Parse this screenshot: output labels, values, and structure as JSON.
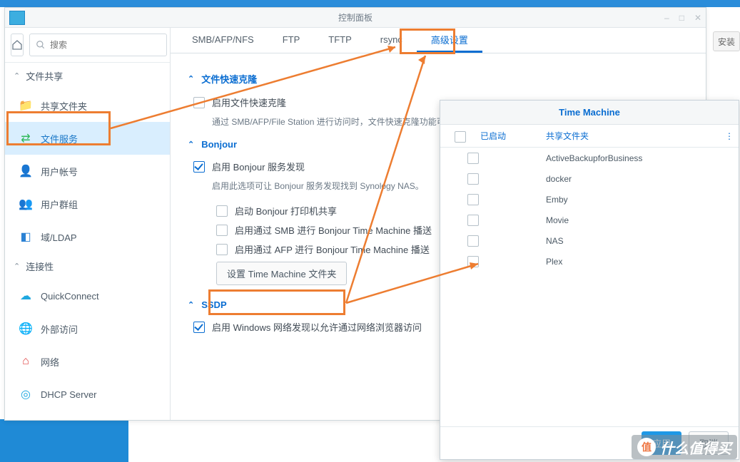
{
  "window": {
    "title": "控制面板"
  },
  "titlebar_controls": [
    "–",
    "□",
    "✕"
  ],
  "search": {
    "placeholder": "搜索"
  },
  "install_label": "安装",
  "sidebar": {
    "sections": [
      {
        "label": "文件共享",
        "items": [
          {
            "key": "shared-folder",
            "label": "共享文件夹",
            "color": "#f2a515",
            "glyph": "📁"
          },
          {
            "key": "file-services",
            "label": "文件服务",
            "color": "#2fb95a",
            "glyph": "⇄",
            "active": true
          },
          {
            "key": "user",
            "label": "用户帐号",
            "color": "#e6892b",
            "glyph": "👤"
          },
          {
            "key": "group",
            "label": "用户群组",
            "color": "#e6892b",
            "glyph": "👥"
          },
          {
            "key": "domain-ldap",
            "label": "域/LDAP",
            "color": "#2b82d4",
            "glyph": "◧"
          }
        ]
      },
      {
        "label": "连接性",
        "items": [
          {
            "key": "quickconnect",
            "label": "QuickConnect",
            "color": "#1fa8e0",
            "glyph": "☁"
          },
          {
            "key": "external-access",
            "label": "外部访问",
            "color": "#1fa8e0",
            "glyph": "🌐"
          },
          {
            "key": "network",
            "label": "网络",
            "color": "#e04040",
            "glyph": "⌂"
          },
          {
            "key": "dhcp",
            "label": "DHCP Server",
            "color": "#1fa8e0",
            "glyph": "◎"
          }
        ]
      }
    ]
  },
  "tabs": [
    "SMB/AFP/NFS",
    "FTP",
    "TFTP",
    "rsync",
    "高级设置"
  ],
  "active_tab": 4,
  "pane": {
    "group1": {
      "title": "文件快速克隆",
      "chk1": "启用文件快速克隆",
      "desc": "通过 SMB/AFP/File Station 进行访问时，文件快速克隆功能可让数据块将仅在克隆文件修改时复制，这将节省存储空间。"
    },
    "group2": {
      "title": "Bonjour",
      "chk1": "启用 Bonjour 服务发现",
      "desc": "启用此选项可让 Bonjour 服务发现找到 Synology NAS。",
      "sub1": "启动 Bonjour 打印机共享",
      "sub2": "启用通过 SMB 进行 Bonjour Time Machine 播送",
      "sub3": "启用通过 AFP 进行 Bonjour Time Machine 播送",
      "btn": "设置 Time Machine 文件夹"
    },
    "group3": {
      "title": "SSDP",
      "chk1": "启用 Windows 网络发现以允许通过网络浏览器访问"
    }
  },
  "dialog": {
    "title": "Time Machine",
    "col_enabled": "已启动",
    "col_folder": "共享文件夹",
    "rows": [
      "ActiveBackupforBusiness",
      "docker",
      "Emby",
      "Movie",
      "NAS",
      "Plex"
    ],
    "ok": "应用",
    "cancel": "取消"
  },
  "watermark": "什么值得买"
}
